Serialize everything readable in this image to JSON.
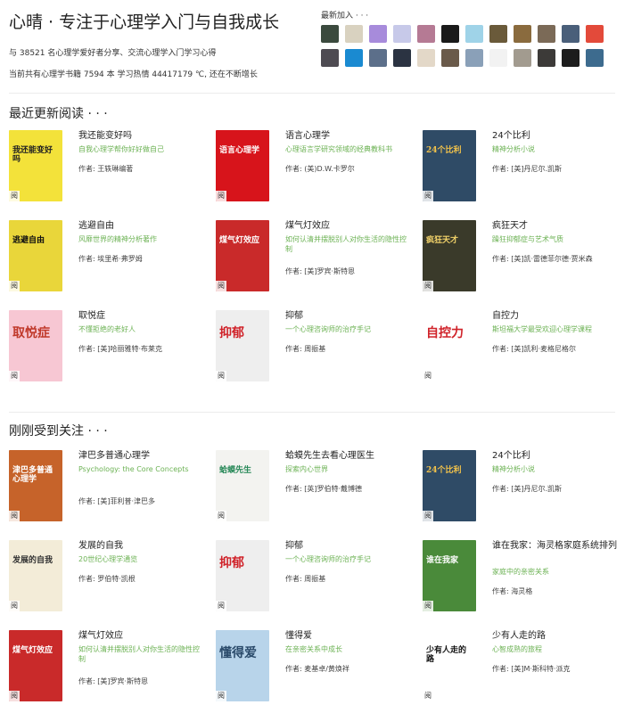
{
  "header": {
    "title": "心晴 · 专注于心理学入门与自我成长",
    "intro": "与 38521 名心理学爱好者分享、交流心理学入门学习心得",
    "stats": "当前共有心理学书籍 7594 本 学习热情 44417179 ℃, 还在不断增长",
    "new_users_label": "最新加入 · · ·",
    "avatar_colors": [
      "#3b4a3e",
      "#d9d2c0",
      "#a78bdb",
      "#c7c9e9",
      "#b57a94",
      "#1a1a1a",
      "#9fd3e8",
      "#6a5a3a",
      "#8a6b3e",
      "#7b6a57",
      "#4a5f7a",
      "#e34a3a",
      "#4e4b52",
      "#1a8ad1",
      "#5c6f8a",
      "#2b3342",
      "#e3d8c8",
      "#6a5a4a",
      "#8aa0b8",
      "#f2f2f2",
      "#a29b8f",
      "#3c3a38",
      "#1d1d1d",
      "#3d6b8e"
    ]
  },
  "sections": [
    {
      "title": "最近更新阅读 · · ·",
      "books": [
        {
          "title": "我还能变好吗",
          "desc": "自我心理学帮你好好做自己",
          "author": "作者: 王轶琳编著",
          "badge": "阅",
          "cover_bg": "#f3e23a",
          "cover_fg": "#222",
          "cover_text": "我还能变好吗"
        },
        {
          "title": "语言心理学",
          "desc": "心理语言学研究领域的经典教科书",
          "author": "作者: (美)D.W.卡罗尔",
          "badge": "阅",
          "cover_bg": "#d7141b",
          "cover_fg": "#fff",
          "cover_text": "语言心理学"
        },
        {
          "title": "24个比利",
          "desc": "精神分析小说",
          "author": "作者: [美]丹尼尔.凯斯",
          "badge": "阅",
          "cover_bg": "#2f4b66",
          "cover_fg": "#f3c34a",
          "cover_text": "24个比利"
        },
        {
          "title": "逃避自由",
          "desc": "风靡世界的精神分析著作",
          "author": "作者: 埃里希·弗罗姆",
          "badge": "阅",
          "cover_bg": "#e9d63a",
          "cover_fg": "#111",
          "cover_text": "逃避自由"
        },
        {
          "title": "煤气灯效应",
          "desc": "如何认清并摆脱别人对你生活的隐性控制",
          "author": "作者: [美]罗宾·斯特恩",
          "badge": "阅",
          "cover_bg": "#c92a2a",
          "cover_fg": "#fff",
          "cover_text": "煤气灯效应"
        },
        {
          "title": "疯狂天才",
          "desc": "躁狂抑郁症与艺术气质",
          "author": "作者: [美]凯·雷德菲尔德·贾米森",
          "badge": "阅",
          "cover_bg": "#3a3a2a",
          "cover_fg": "#f3d36a",
          "cover_text": "疯狂天才"
        },
        {
          "title": "取悦症",
          "desc": "不懂拒绝的老好人",
          "author": "作者: [美]哈丽雅特·布莱克",
          "badge": "阅",
          "cover_bg": "#f7c7d3",
          "cover_fg": "#c0392b",
          "cover_text": "取悦症"
        },
        {
          "title": "抑郁",
          "desc": "一个心理咨询师的治疗手记",
          "author": "作者: 周振基",
          "badge": "阅",
          "cover_bg": "#eeeeee",
          "cover_fg": "#d0232a",
          "cover_text": "抑郁"
        },
        {
          "title": "自控力",
          "desc": "斯坦福大学最受欢迎心理学课程",
          "author": "作者: [美]凯利·麦格尼格尔",
          "badge": "阅",
          "cover_bg": "#ffffff",
          "cover_fg": "#d0232a",
          "cover_text": "自控力"
        }
      ]
    },
    {
      "title": "刚刚受到关注 · · ·",
      "books": [
        {
          "title": "津巴多普通心理学",
          "desc": "Psychology: the Core Concepts",
          "author": "作者: [美]菲利普·津巴多",
          "badge": "阅",
          "cover_bg": "#c6632a",
          "cover_fg": "#fff",
          "cover_text": "津巴多普通心理学"
        },
        {
          "title": "蛤蟆先生去看心理医生",
          "desc": "探索内心世界",
          "author": "作者: [英]罗伯特·戴博德",
          "badge": "阅",
          "cover_bg": "#f3f3f0",
          "cover_fg": "#2a8a5a",
          "cover_text": "蛤蟆先生"
        },
        {
          "title": "24个比利",
          "desc": "精神分析小说",
          "author": "作者: [美]丹尼尔.凯斯",
          "badge": "阅",
          "cover_bg": "#2f4b66",
          "cover_fg": "#f3c34a",
          "cover_text": "24个比利"
        },
        {
          "title": "发展的自我",
          "desc": "20世纪心理学通览",
          "author": "作者: 罗伯特·凯根",
          "badge": "阅",
          "cover_bg": "#f3ecd8",
          "cover_fg": "#333",
          "cover_text": "发展的自我"
        },
        {
          "title": "抑郁",
          "desc": "一个心理咨询师的治疗手记",
          "author": "作者: 周振基",
          "badge": "阅",
          "cover_bg": "#eeeeee",
          "cover_fg": "#d0232a",
          "cover_text": "抑郁"
        },
        {
          "title": "谁在我家：海灵格家庭系统排列",
          "desc": "家庭中的亲密关系",
          "author": "作者: 海灵格",
          "badge": "阅",
          "cover_bg": "#4a8a3a",
          "cover_fg": "#fff",
          "cover_text": "谁在我家"
        },
        {
          "title": "煤气灯效应",
          "desc": "如何认清并摆脱别人对你生活的隐性控制",
          "author": "作者: [美]罗宾·斯特恩",
          "badge": "阅",
          "cover_bg": "#c92a2a",
          "cover_fg": "#fff",
          "cover_text": "煤气灯效应"
        },
        {
          "title": "懂得爱",
          "desc": "在亲密关系中成长",
          "author": "作者: 麦基卓/黄焕祥",
          "badge": "阅",
          "cover_bg": "#b8d4ea",
          "cover_fg": "#2a4a6a",
          "cover_text": "懂得爱"
        },
        {
          "title": "少有人走的路",
          "desc": "心智成熟的旅程",
          "author": "作者: [美]M·斯科特·派克",
          "badge": "阅",
          "cover_bg": "#ffffff",
          "cover_fg": "#111",
          "cover_text": "少有人走的路"
        }
      ]
    }
  ]
}
